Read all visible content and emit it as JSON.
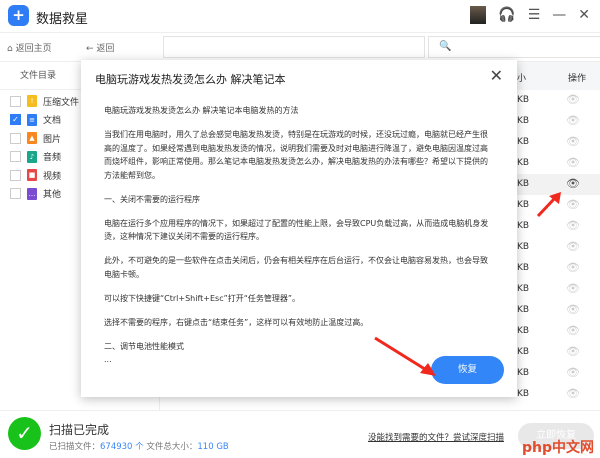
{
  "app": {
    "title": "数据救星"
  },
  "toolbar": {
    "home": "返回主页",
    "back": "返回"
  },
  "sidebar": {
    "header": "文件目录",
    "items": [
      {
        "label": "压缩文件",
        "checked": false,
        "color": "#f5bd1f"
      },
      {
        "label": "文档",
        "checked": true,
        "color": "#2f7df5"
      },
      {
        "label": "图片",
        "checked": false,
        "color": "#f7871e"
      },
      {
        "label": "音频",
        "checked": false,
        "color": "#1aa68a"
      },
      {
        "label": "视频",
        "checked": false,
        "color": "#e64848"
      },
      {
        "label": "其他",
        "checked": false,
        "color": "#7b4bd1"
      }
    ]
  },
  "table": {
    "header_size": "小",
    "header_action": "操作",
    "size_unit": "KB",
    "rows": 15,
    "highlight_row": 4
  },
  "modal": {
    "title": "电脑玩游戏发热发烫怎么办 解决笔记本",
    "paragraphs": [
      "电脑玩游戏发热发烫怎么办 解决笔记本电脑发热的方法",
      "当我们在用电脑时，用久了总会感觉电脑发热发烫，特别是在玩游戏的时候，还没玩过瘾，电脑就已经产生很高的温度了。如果经常遇到电脑发热发烫的情况，说明我们需要及时对电脑进行降温了，避免电脑因温度过高而烧坏组件，影响正常使用。那么笔记本电脑发热发烫怎么办，解决电脑发热的办法有哪些？希望以下提供的方法能帮到您。",
      "一、关闭不需要的运行程序",
      "电脑在运行多个应用程序的情况下，如果超过了配置的性能上限，会导致CPU负载过高，从而造成电脑机身发烫，这种情况下建议关闭不需要的运行程序。",
      "此外，不可避免的是一些软件在点击关闭后，仍会有相关程序在后台运行，不仅会让电脑容易发热，也会导致电脑卡顿。",
      "可以按下快捷键“Ctrl+Shift+Esc”打开“任务管理器”。",
      "选择不需要的程序，右键点击“结束任务”，这样可以有效地防止温度过高。"
    ],
    "last_heading": "二、调节电池性能模式",
    "ellipsis": "...",
    "restore": "恢复"
  },
  "bottom": {
    "status": "扫描已完成",
    "scanned_label": "已扫描文件：",
    "scanned_count": "674930 个",
    "size_label": "文件总大小：",
    "size": "110 GB",
    "deep_link": "没能找到需要的文件？尝试深度扫描",
    "recover": "立即恢复"
  },
  "watermark": "php中文网"
}
